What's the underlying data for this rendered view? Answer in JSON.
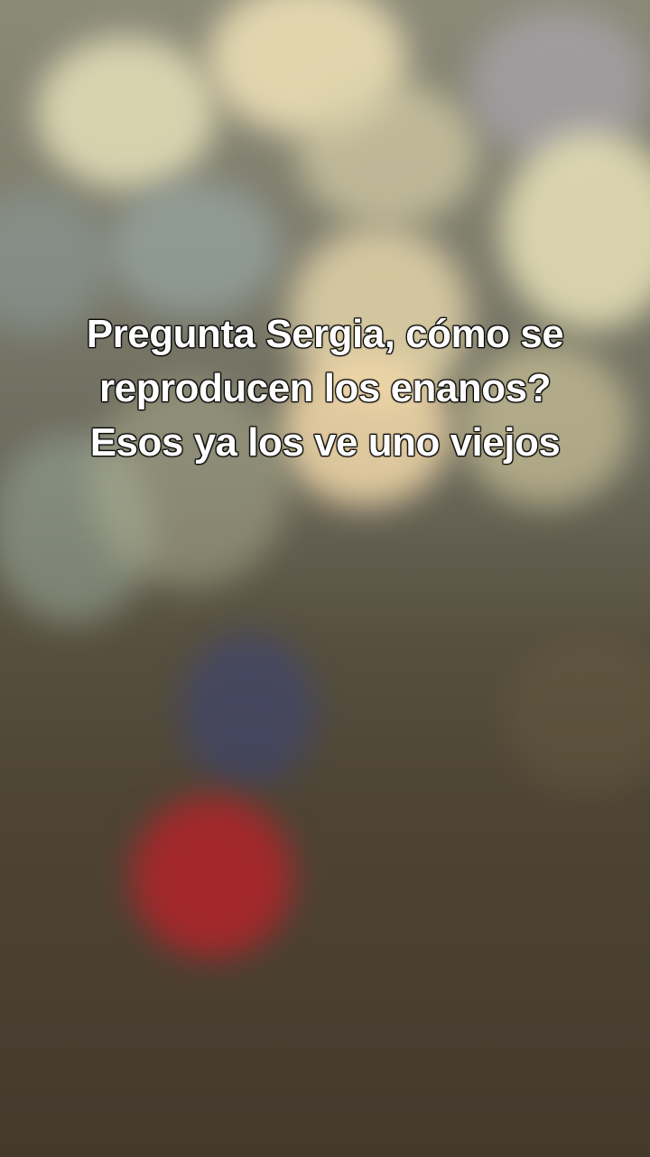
{
  "caption": {
    "lines": [
      "Pregunta Sergia, cómo se",
      "reproducen los enanos?",
      "Esos ya los ve uno viejos"
    ]
  },
  "colors": {
    "caption_text": "#ffffff",
    "caption_outline": "#000000",
    "background_top": "#8b8a78",
    "background_bottom": "#45392c",
    "bokeh_red": "#b2242a",
    "bokeh_blue": "#3c4477",
    "bokeh_warm": "#f2d8a9"
  }
}
